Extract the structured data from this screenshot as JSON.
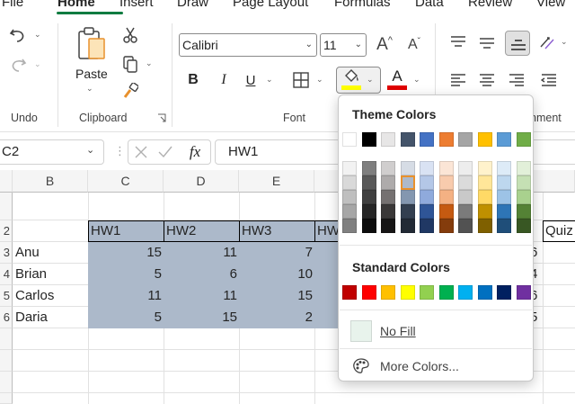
{
  "menu": {
    "tabs": [
      "File",
      "Home",
      "Insert",
      "Draw",
      "Page Layout",
      "Formulas",
      "Data",
      "Review",
      "View"
    ]
  },
  "ribbon": {
    "groups": {
      "undo": "Undo",
      "clipboard": "Clipboard",
      "font": "Font",
      "alignment": "nment"
    },
    "paste_label": "Paste",
    "font_name": "Calibri",
    "font_size": "11",
    "bold": "B",
    "italic": "I",
    "underline": "U",
    "grow_font": "A",
    "shrink_font": "A",
    "font_color_letter": "A",
    "fill_color": "#ffff00",
    "font_color": "#e00000"
  },
  "formula_bar": {
    "name_box": "C2",
    "fx": "fx",
    "value": "HW1"
  },
  "sheet": {
    "columns": [
      "B",
      "C",
      "D",
      "E"
    ],
    "row_labels": [
      "2",
      "3",
      "4",
      "5",
      "6"
    ],
    "header_row": [
      "HW1",
      "HW2",
      "HW3",
      "HW"
    ],
    "rows": [
      {
        "name": "Anu",
        "c": "15",
        "d": "11",
        "e": "7"
      },
      {
        "name": "Brian",
        "c": "5",
        "d": "6",
        "e": "10"
      },
      {
        "name": "Carlos",
        "c": "11",
        "d": "11",
        "e": "15"
      },
      {
        "name": "Daria",
        "c": "5",
        "d": "15",
        "e": "2"
      }
    ],
    "quiz_header": "Quiz",
    "right_partial_values": [
      "6",
      "4",
      "6",
      "5"
    ],
    "fill_color": "#acb9ca"
  },
  "palette": {
    "theme_title": "Theme Colors",
    "standard_title": "Standard Colors",
    "no_fill": "No Fill",
    "more_colors": "More Colors...",
    "theme_top": [
      "#ffffff",
      "#000000",
      "#e7e6e6",
      "#44546a",
      "#4472c4",
      "#ed7d31",
      "#a5a5a5",
      "#ffc000",
      "#5b9bd5",
      "#70ad47"
    ],
    "theme_shades": [
      [
        "#f2f2f2",
        "#7f7f7f",
        "#d0cece",
        "#d6dce5",
        "#d9e2f3",
        "#fbe5d6",
        "#ededed",
        "#fff2cc",
        "#ddebf7",
        "#e2f0d9"
      ],
      [
        "#d9d9d9",
        "#595959",
        "#aeabab",
        "#adb9ca",
        "#b4c7e7",
        "#f8cbad",
        "#dbdbdb",
        "#ffe699",
        "#bdd7ee",
        "#c5e0b4"
      ],
      [
        "#bfbfbf",
        "#404040",
        "#757171",
        "#8497b0",
        "#8faadc",
        "#f4b183",
        "#c9c9c9",
        "#ffd966",
        "#9dc3e6",
        "#a9d18e"
      ],
      [
        "#a6a6a6",
        "#262626",
        "#3a3838",
        "#333f50",
        "#2f5597",
        "#c55a11",
        "#7b7b7b",
        "#bf9000",
        "#2e75b6",
        "#548235"
      ],
      [
        "#808080",
        "#0d0d0d",
        "#171616",
        "#222a35",
        "#203864",
        "#843c0c",
        "#525252",
        "#7f6000",
        "#1f4e79",
        "#385723"
      ]
    ],
    "selected_shade": "#adb9ca",
    "standard": [
      "#c00000",
      "#ff0000",
      "#ffc000",
      "#ffff00",
      "#92d050",
      "#00b050",
      "#00b0f0",
      "#0070c0",
      "#002060",
      "#7030a0"
    ]
  }
}
